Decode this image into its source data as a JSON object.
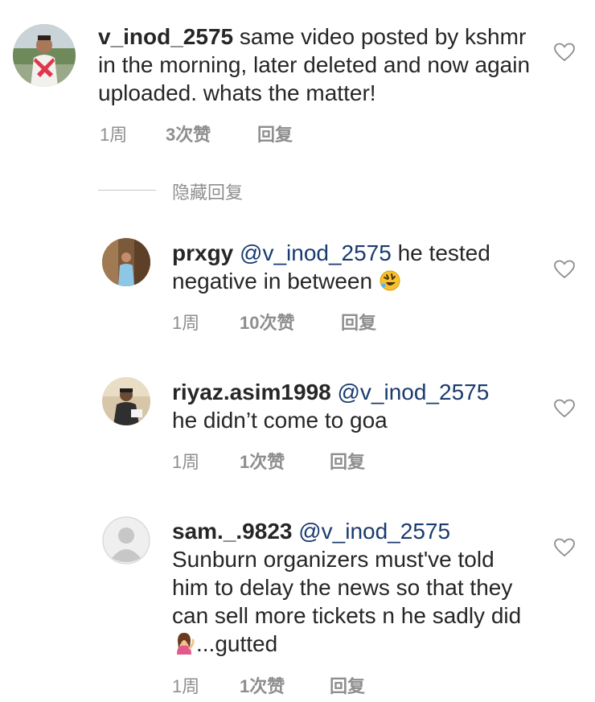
{
  "comments": [
    {
      "username": "v_inod_2575",
      "mention": "",
      "text": "same video posted by kshmr in the morning, later deleted and now again uploaded. whats the matter!",
      "time": "1周",
      "likes": "3次赞",
      "reply": "回复"
    },
    {
      "username": "prxgy",
      "mention": "@v_inod_2575",
      "text": "he tested negative in between",
      "time": "1周",
      "likes": "10次赞",
      "reply": "回复"
    },
    {
      "username": "riyaz.asim1998",
      "mention": "@v_inod_2575",
      "text": "he didn’t come to goa",
      "time": "1周",
      "likes": "1次赞",
      "reply": "回复"
    },
    {
      "username": "sam._.9823",
      "mention": "@v_inod_2575",
      "text": "Sunburn organizers must've told him to delay the news so that they can sell more tickets n he sadly did",
      "text_after_emoji": "...gutted",
      "time": "1周",
      "likes": "1次赞",
      "reply": "回复"
    }
  ],
  "hide_replies": "隐藏回复",
  "icons": {
    "like": "heart-outline-icon",
    "laughing_emoji": "rolling-on-floor-laughing-emoji",
    "shrug_emoji": "woman-tipping-hand-emoji",
    "default_avatar": "default-avatar-icon"
  },
  "colors": {
    "text": "#262626",
    "meta": "#8e8e8e",
    "mention": "#1a3b6e",
    "divider": "#c7c7c7"
  }
}
